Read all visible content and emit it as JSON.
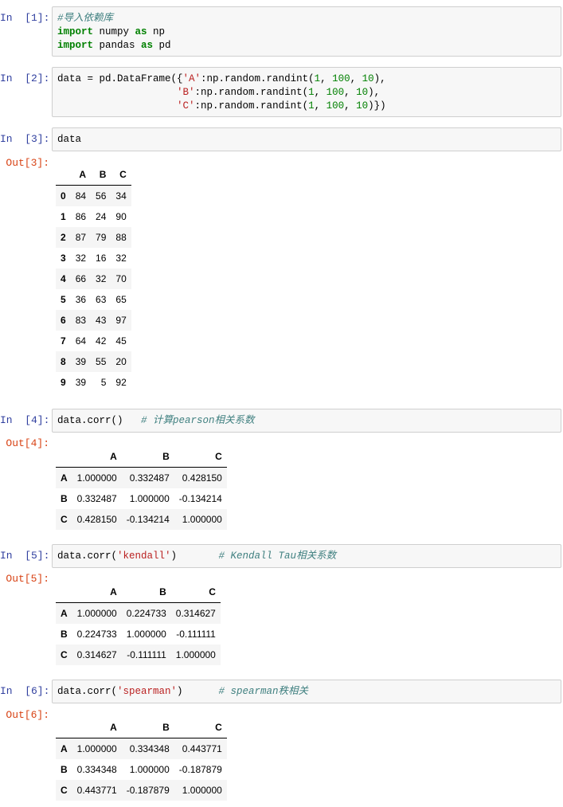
{
  "cells": [
    {
      "in_prompt": "In  [1]:",
      "code_lines": [
        [
          {
            "t": "cm",
            "s": "#导入依赖库"
          }
        ],
        [
          {
            "t": "kw",
            "s": "import"
          },
          {
            "t": "plain",
            "s": " numpy "
          },
          {
            "t": "kw",
            "s": "as"
          },
          {
            "t": "plain",
            "s": " np"
          }
        ],
        [
          {
            "t": "kw",
            "s": "import"
          },
          {
            "t": "plain",
            "s": " pandas "
          },
          {
            "t": "kw",
            "s": "as"
          },
          {
            "t": "plain",
            "s": " pd"
          }
        ]
      ]
    },
    {
      "in_prompt": "In  [2]:",
      "code_lines": [
        [
          {
            "t": "plain",
            "s": "data = pd.DataFrame({"
          },
          {
            "t": "st",
            "s": "'A'"
          },
          {
            "t": "plain",
            "s": ":np.random.randint("
          },
          {
            "t": "num",
            "s": "1"
          },
          {
            "t": "plain",
            "s": ", "
          },
          {
            "t": "num",
            "s": "100"
          },
          {
            "t": "plain",
            "s": ", "
          },
          {
            "t": "num",
            "s": "10"
          },
          {
            "t": "plain",
            "s": "),"
          }
        ],
        [
          {
            "t": "plain",
            "s": "                    "
          },
          {
            "t": "st",
            "s": "'B'"
          },
          {
            "t": "plain",
            "s": ":np.random.randint("
          },
          {
            "t": "num",
            "s": "1"
          },
          {
            "t": "plain",
            "s": ", "
          },
          {
            "t": "num",
            "s": "100"
          },
          {
            "t": "plain",
            "s": ", "
          },
          {
            "t": "num",
            "s": "10"
          },
          {
            "t": "plain",
            "s": "),"
          }
        ],
        [
          {
            "t": "plain",
            "s": "                    "
          },
          {
            "t": "st",
            "s": "'C'"
          },
          {
            "t": "plain",
            "s": ":np.random.randint("
          },
          {
            "t": "num",
            "s": "1"
          },
          {
            "t": "plain",
            "s": ", "
          },
          {
            "t": "num",
            "s": "100"
          },
          {
            "t": "plain",
            "s": ", "
          },
          {
            "t": "num",
            "s": "10"
          },
          {
            "t": "plain",
            "s": ")})"
          }
        ]
      ]
    },
    {
      "in_prompt": "In  [3]:",
      "out_prompt": "Out[3]:",
      "code_lines": [
        [
          {
            "t": "plain",
            "s": "data"
          }
        ]
      ],
      "table": {
        "columns": [
          "",
          "A",
          "B",
          "C"
        ],
        "rows": [
          [
            "0",
            "84",
            "56",
            "34"
          ],
          [
            "1",
            "86",
            "24",
            "90"
          ],
          [
            "2",
            "87",
            "79",
            "88"
          ],
          [
            "3",
            "32",
            "16",
            "32"
          ],
          [
            "4",
            "66",
            "32",
            "70"
          ],
          [
            "5",
            "36",
            "63",
            "65"
          ],
          [
            "6",
            "83",
            "43",
            "97"
          ],
          [
            "7",
            "64",
            "42",
            "45"
          ],
          [
            "8",
            "39",
            "55",
            "20"
          ],
          [
            "9",
            "39",
            "5",
            "92"
          ]
        ]
      }
    },
    {
      "in_prompt": "In  [4]:",
      "out_prompt": "Out[4]:",
      "code_lines": [
        [
          {
            "t": "plain",
            "s": "data.corr()   "
          },
          {
            "t": "cm",
            "s": "# 计算pearson相关系数"
          }
        ]
      ],
      "table": {
        "columns": [
          "",
          "A",
          "B",
          "C"
        ],
        "rows": [
          [
            "A",
            "1.000000",
            "0.332487",
            "0.428150"
          ],
          [
            "B",
            "0.332487",
            "1.000000",
            "-0.134214"
          ],
          [
            "C",
            "0.428150",
            "-0.134214",
            "1.000000"
          ]
        ]
      }
    },
    {
      "in_prompt": "In  [5]:",
      "out_prompt": "Out[5]:",
      "code_lines": [
        [
          {
            "t": "plain",
            "s": "data.corr("
          },
          {
            "t": "st",
            "s": "'kendall'"
          },
          {
            "t": "plain",
            "s": ")       "
          },
          {
            "t": "cm",
            "s": "# Kendall Tau相关系数"
          }
        ]
      ],
      "table": {
        "columns": [
          "",
          "A",
          "B",
          "C"
        ],
        "rows": [
          [
            "A",
            "1.000000",
            "0.224733",
            "0.314627"
          ],
          [
            "B",
            "0.224733",
            "1.000000",
            "-0.111111"
          ],
          [
            "C",
            "0.314627",
            "-0.111111",
            "1.000000"
          ]
        ]
      }
    },
    {
      "in_prompt": "In  [6]:",
      "out_prompt": "Out[6]:",
      "code_lines": [
        [
          {
            "t": "plain",
            "s": "data.corr("
          },
          {
            "t": "st",
            "s": "'spearman'"
          },
          {
            "t": "plain",
            "s": ")      "
          },
          {
            "t": "cm",
            "s": "# spearman秩相关"
          }
        ]
      ],
      "table": {
        "columns": [
          "",
          "A",
          "B",
          "C"
        ],
        "rows": [
          [
            "A",
            "1.000000",
            "0.334348",
            "0.443771"
          ],
          [
            "B",
            "0.334348",
            "1.000000",
            "-0.187879"
          ],
          [
            "C",
            "0.443771",
            "-0.187879",
            "1.000000"
          ]
        ]
      }
    }
  ]
}
